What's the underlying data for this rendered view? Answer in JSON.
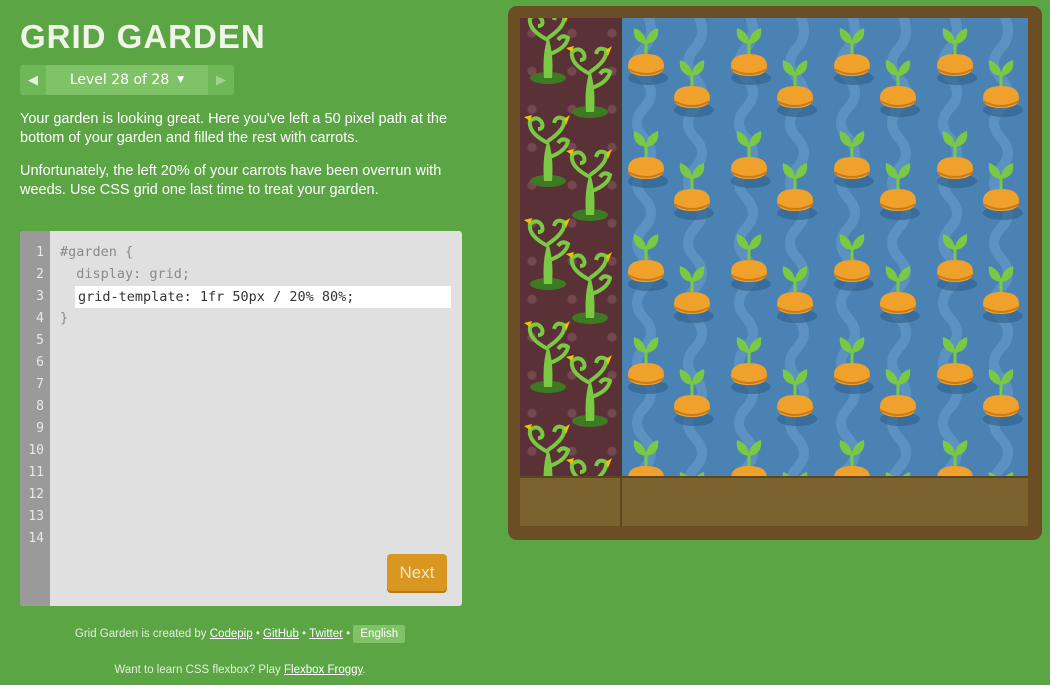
{
  "app": {
    "title": "GRID GARDEN"
  },
  "level_nav": {
    "label": "Level 28 of 28",
    "prev_icon": "triangle-left",
    "next_icon": "triangle-right",
    "caret_icon": "caret-down"
  },
  "instructions": {
    "p1": "Your garden is looking great. Here you've left a 50 pixel path at the bottom of your garden and filled the rest with carrots.",
    "p2": "Unfortunately, the left 20% of your carrots have been overrun with weeds. Use CSS grid one last time to treat your garden."
  },
  "editor": {
    "line_numbers": [
      "1",
      "2",
      "3",
      "4",
      "5",
      "6",
      "7",
      "8",
      "9",
      "10",
      "11",
      "12",
      "13",
      "14"
    ],
    "line1": "#garden {",
    "line2": "  display: grid;",
    "line4": "}",
    "input_value": "grid-template: 1fr 50px / 20% 80%;",
    "next_label": "Next"
  },
  "footer": {
    "created_by": "Grid Garden is created by",
    "codepip": "Codepip",
    "sep": "•",
    "github": "GitHub",
    "twitter": "Twitter",
    "language": "English",
    "promo_prefix": "Want to learn CSS flexbox? Play",
    "promo_link": "Flexbox Froggy",
    "promo_suffix": "."
  },
  "colors": {
    "background": "#5ba545",
    "water": "#4a82b4",
    "soil": "#7c622f",
    "weeds_bg": "#5b3138",
    "carrot": "#f0a12c",
    "leaf": "#7ac943",
    "button": "#d99722"
  }
}
